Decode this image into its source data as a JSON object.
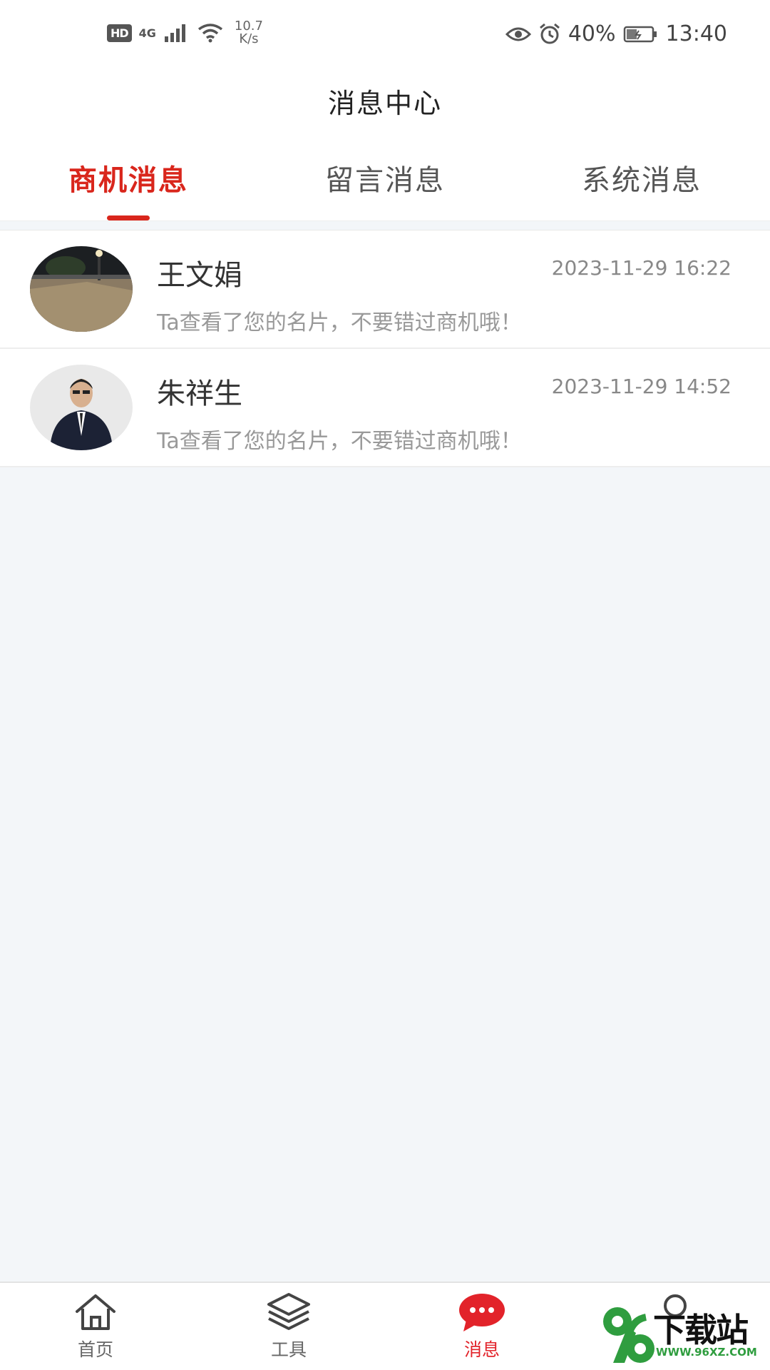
{
  "status_bar": {
    "hd": "HD",
    "network": "4G",
    "speed_value": "10.7",
    "speed_unit": "K/s",
    "battery": "40%",
    "time": "13:40"
  },
  "header": {
    "title": "消息中心"
  },
  "tabs": [
    {
      "label": "商机消息",
      "active": true
    },
    {
      "label": "留言消息",
      "active": false
    },
    {
      "label": "系统消息",
      "active": false
    }
  ],
  "messages": [
    {
      "name": "王文娟",
      "time": "2023-11-29 16:22",
      "preview": "Ta查看了您的名片，不要错过商机哦！"
    },
    {
      "name": "朱祥生",
      "time": "2023-11-29 14:52",
      "preview": "Ta查看了您的名片，不要错过商机哦！"
    }
  ],
  "bottom_nav": [
    {
      "label": "首页",
      "icon": "home-icon"
    },
    {
      "label": "工具",
      "icon": "layers-icon"
    },
    {
      "label": "消息",
      "icon": "chat-bubble-icon",
      "active": true
    },
    {
      "label": "",
      "icon": "user-icon"
    }
  ],
  "watermark": {
    "text": "下载站",
    "url": "WWW.96XZ.COM",
    "number": "96"
  },
  "colors": {
    "accent": "#d9261c",
    "nav_active": "#e2232a",
    "background": "#f3f6f9"
  }
}
